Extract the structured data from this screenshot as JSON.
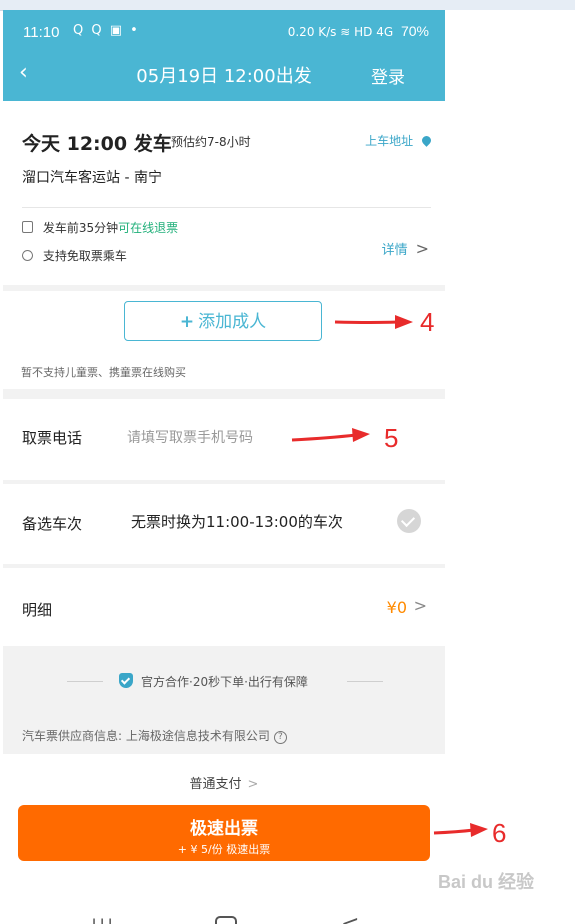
{
  "status_bar": {
    "time": "11:10",
    "left_icons": "Q Q ▣ •",
    "right_icons": "0.20 K/s ≋ HD 4G",
    "battery": "70%"
  },
  "header": {
    "back_icon": "‹",
    "title": "05月19日 12:00出发",
    "login": "登录"
  },
  "trip": {
    "depart": "今天 12:00 发车",
    "duration": "预估约7-8小时",
    "pickup": "上车地址",
    "route": "溜口汽车客运站 - 南宁",
    "refund_prefix": "发车前35分钟",
    "refund_highlight": "可在线退票",
    "no_ticket": "支持免取票乘车",
    "detail": "详情"
  },
  "passenger": {
    "add_adult": "添加成人",
    "child_note": "暂不支持儿童票、携童票在线购买"
  },
  "phone": {
    "label": "取票电话",
    "placeholder": "请填写取票手机号码"
  },
  "alternate": {
    "label": "备选车次",
    "value": "无票时换为11:00-13:00的车次"
  },
  "fee": {
    "label": "明细",
    "amount": "¥0"
  },
  "assurance": "官方合作·20秒下单·出行有保障",
  "supplier": "汽车票供应商信息: 上海极途信息技术有限公司",
  "payment": {
    "normal": "普通支付",
    "fast_title": "极速出票",
    "fast_sub": "+ ¥ 5/份 极速出票"
  },
  "annotations": [
    "4",
    "5",
    "6"
  ],
  "watermark": "Bai du 经验",
  "colors": {
    "header": "#4ab6d3",
    "accent": "#3aa6c8",
    "green": "#21b07a",
    "orange": "#ff6a00",
    "price": "#ff8a00",
    "arrow": "#e82b2b"
  }
}
